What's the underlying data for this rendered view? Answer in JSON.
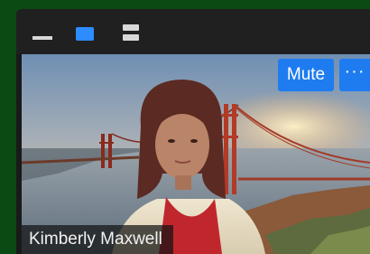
{
  "window": {
    "title_bar": {
      "minimize_icon": "minimize-icon",
      "speaker_view_icon": "speaker-view-icon",
      "gallery_view_icon": "gallery-view-icon"
    }
  },
  "video": {
    "participant_name": "Kimberly Maxwell",
    "mute_label": "Mute",
    "more_label": "···",
    "more_icon": "more-options-icon",
    "accent_color": "#2d8cff"
  }
}
